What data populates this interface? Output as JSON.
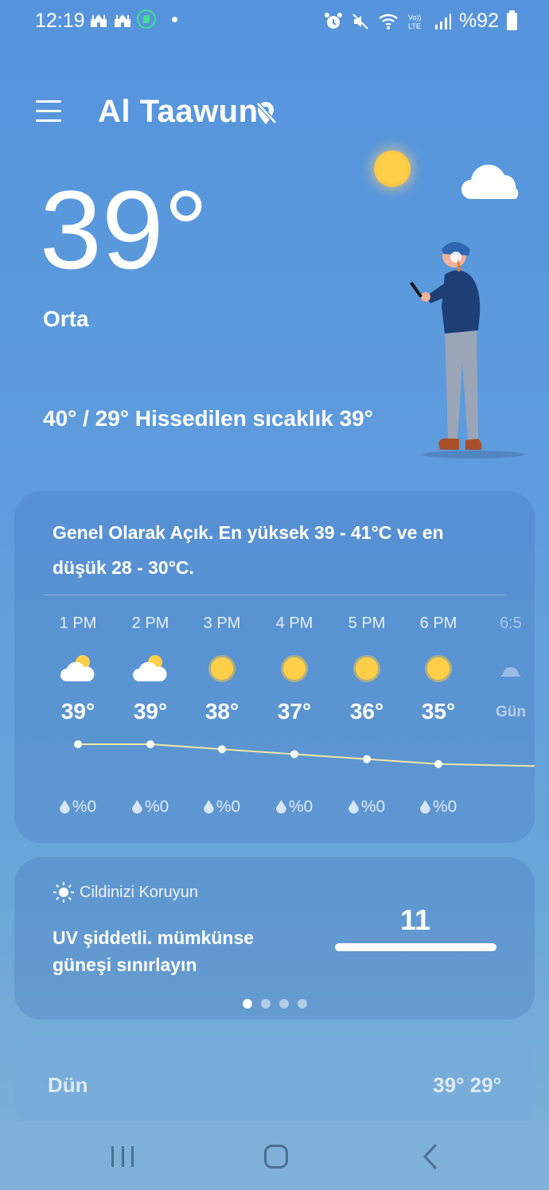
{
  "status_bar": {
    "time": "12:19",
    "battery": "%92"
  },
  "header": {
    "location": "Al Taawun"
  },
  "current": {
    "temperature": "39°",
    "condition": "Orta",
    "hi_lo_feels": "40° / 29° Hissedilen sıcaklık 39°"
  },
  "forecast": {
    "summary": "Genel Olarak Açık. En yüksek 39 - 41°C ve en düşük 28 - 30°C.",
    "hours": [
      {
        "time": "1 PM",
        "icon": "partly-cloudy-icon",
        "temp": "39°",
        "precip": "%0",
        "value": 39
      },
      {
        "time": "2 PM",
        "icon": "partly-cloudy-icon",
        "temp": "39°",
        "precip": "%0",
        "value": 39
      },
      {
        "time": "3 PM",
        "icon": "sun-icon",
        "temp": "38°",
        "precip": "%0",
        "value": 38
      },
      {
        "time": "4 PM",
        "icon": "sun-icon",
        "temp": "37°",
        "precip": "%0",
        "value": 37
      },
      {
        "time": "5 PM",
        "icon": "sun-icon",
        "temp": "36°",
        "precip": "%0",
        "value": 36
      },
      {
        "time": "6 PM",
        "icon": "sun-icon",
        "temp": "35°",
        "precip": "%0",
        "value": 35
      },
      {
        "time": "6:5",
        "icon": "sunset-icon",
        "temp": "Gün",
        "precip": "",
        "value": 34.7
      }
    ]
  },
  "uv": {
    "heading": "Cildinizi Koruyun",
    "text": "UV şiddetli. mümkünse güneşi sınırlayın",
    "index": "11"
  },
  "yesterday": {
    "label": "Dün",
    "temps": "39° 29°"
  },
  "colors": {
    "background": "#5594dc",
    "sun": "#ffcf4a",
    "temp_line": "#f1e6a0"
  }
}
